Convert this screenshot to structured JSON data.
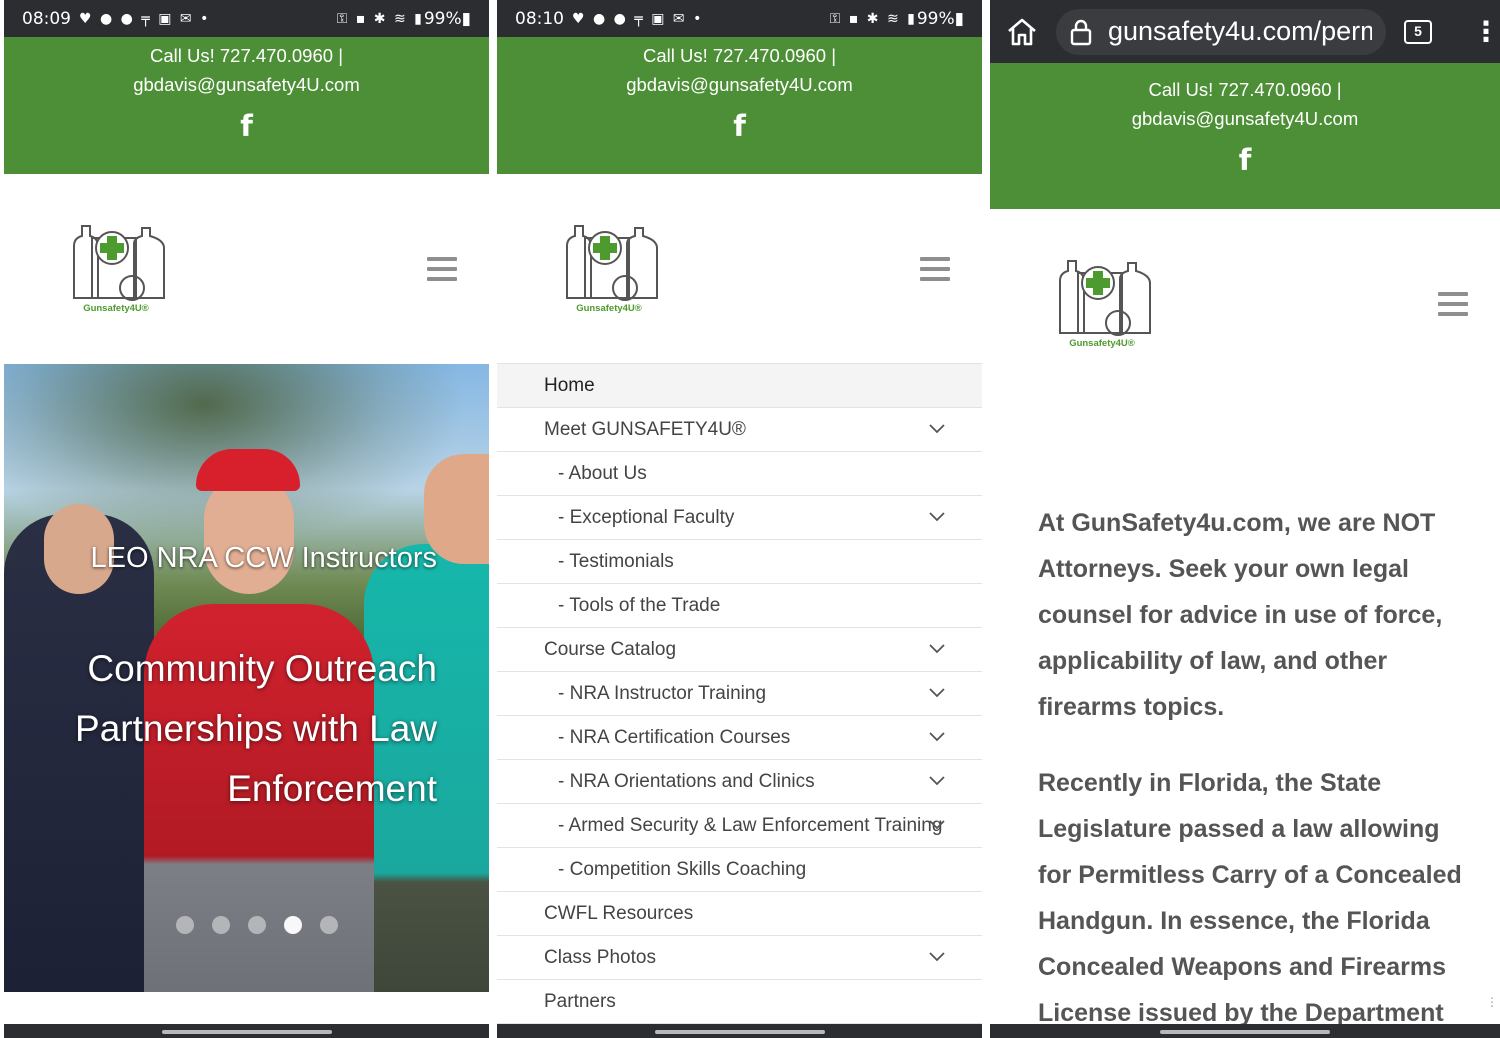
{
  "panel1": {
    "status": {
      "time": "08:09",
      "icons": "♥ ● ● ╤ ▣ ✉ •",
      "right_icons": "⚿ ▪ ✱ ≋ ▮",
      "battery": "99%▮"
    },
    "contact": {
      "phone_line": "Call Us! 727.470.0960  |",
      "email": "gbdavis@gunsafety4U.com",
      "social": "f"
    },
    "logo_text": "Gunsafety4U®",
    "hero": {
      "leo_text": "LEO NRA CCW Instructors",
      "title": "Community Outreach Partnerships with Law Enforcement",
      "slide_count": 5,
      "active_slide": 4
    }
  },
  "panel2": {
    "status": {
      "time": "08:10",
      "icons": "♥ ● ● ╤ ▣ ✉ •",
      "right_icons": "⚿ ▪ ✱ ≋ ▮",
      "battery": "99%▮"
    },
    "contact": {
      "phone_line": "Call Us! 727.470.0960  |",
      "email": "gbdavis@gunsafety4U.com",
      "social": "f"
    },
    "logo_text": "Gunsafety4U®",
    "menu": [
      {
        "label": "Home",
        "sub": false,
        "chevron": false,
        "active": true
      },
      {
        "label": "Meet GUNSAFETY4U®",
        "sub": false,
        "chevron": true
      },
      {
        "label": "- About Us",
        "sub": true,
        "chevron": false
      },
      {
        "label": "- Exceptional Faculty",
        "sub": true,
        "chevron": true
      },
      {
        "label": "- Testimonials",
        "sub": true,
        "chevron": false
      },
      {
        "label": "- Tools of the Trade",
        "sub": true,
        "chevron": false
      },
      {
        "label": "Course Catalog",
        "sub": false,
        "chevron": true
      },
      {
        "label": "- NRA Instructor Training",
        "sub": true,
        "chevron": true
      },
      {
        "label": "- NRA Certification Courses",
        "sub": true,
        "chevron": true
      },
      {
        "label": "- NRA Orientations and Clinics",
        "sub": true,
        "chevron": true
      },
      {
        "label": "- Armed Security & Law Enforcement Training",
        "sub": true,
        "chevron": true
      },
      {
        "label": "- Competition Skills Coaching",
        "sub": true,
        "chevron": false
      },
      {
        "label": "CWFL Resources",
        "sub": false,
        "chevron": false
      },
      {
        "label": "Class Photos",
        "sub": false,
        "chevron": true
      },
      {
        "label": "Partners",
        "sub": false,
        "chevron": false
      }
    ]
  },
  "panel3": {
    "browser": {
      "url": "gunsafety4u.com/perm",
      "tab_count": "5"
    },
    "contact": {
      "phone_line": "Call Us! 727.470.0960  |",
      "email": "gbdavis@gunsafety4U.com",
      "social": "f"
    },
    "logo_text": "Gunsafety4U®",
    "article": {
      "p1": "At GunSafety4u.com, we are NOT Attorneys. Seek your own legal counsel for advice in use of force, applicability of law, and other firearms topics.",
      "p2": "Recently in Florida, the State Legislature passed a law allowing for Permitless Carry of a Concealed Handgun. In essence, the Florida Concealed Weapons and Firearms License issued by the Department"
    },
    "edge_mark": "⋮"
  },
  "colors": {
    "green": "#4d8f37",
    "status_bar": "#2b2d31",
    "logo_green": "#4d9a2e",
    "article_text": "#555555"
  }
}
